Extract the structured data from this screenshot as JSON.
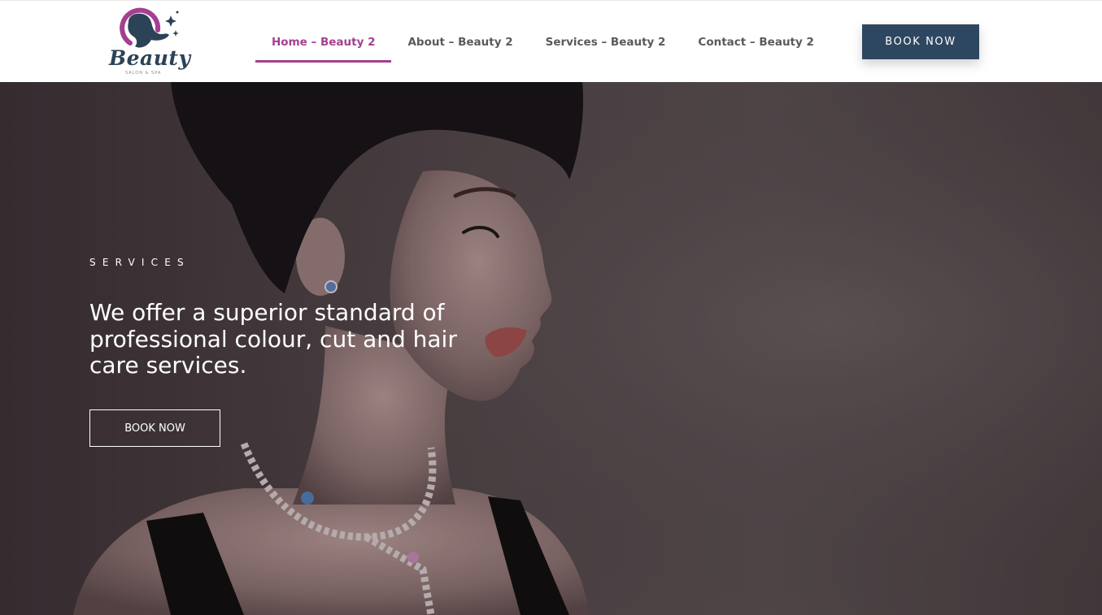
{
  "logo": {
    "wordmark": "Beauty",
    "tagline": "SALON & SPA"
  },
  "nav": {
    "items": [
      {
        "label": "Home – Beauty 2",
        "active": true
      },
      {
        "label": "About – Beauty 2",
        "active": false
      },
      {
        "label": "Services – Beauty 2",
        "active": false
      },
      {
        "label": "Contact – Beauty 2",
        "active": false
      }
    ]
  },
  "header_button": {
    "label": "BOOK NOW"
  },
  "hero": {
    "kicker": "SERVICES",
    "heading": "We offer a superior standard of professional colour, cut and hair care services.",
    "button_label": "BOOK NOW",
    "photo_icon": "woman-portrait-image"
  },
  "colors": {
    "brand_accent": "#a43f91",
    "button_dark": "#2e4760",
    "nav_text": "#5a5a5a",
    "hero_background": "#54484a"
  }
}
